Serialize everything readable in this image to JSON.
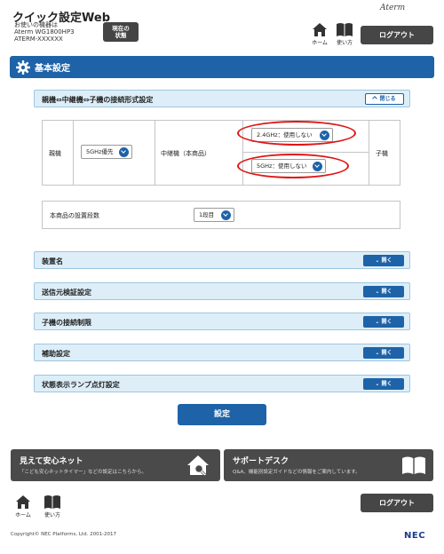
{
  "header": {
    "title": "クイック設定Web",
    "device_label": "お使いの機器は",
    "device_model": "Aterm WG1800HP3",
    "device_serial": "ATERM-XXXXXX",
    "status_button": "現在の\n状態",
    "brand": "Aterm",
    "home_label": "ホーム",
    "help_label": "使い方",
    "logout_label": "ログアウト"
  },
  "page_title": "基本設定",
  "connection_section": {
    "label": "親機⇔中継機⇔子機の接続形式設定",
    "close_button": "閉じる",
    "parent_label": "親機",
    "parent_select": "5GHz優先",
    "repeater_label": "中継機（本商品）",
    "repeater_24_select": "2.4GHz：使用しない",
    "repeater_5_select": "5GHz：使用しない",
    "child_label": "子機"
  },
  "install": {
    "label": "本商品の設置段数",
    "select": "1段目"
  },
  "sections": [
    {
      "label": "装置名",
      "button": "開く"
    },
    {
      "label": "送信元検証設定",
      "button": "開く"
    },
    {
      "label": "子機の接続制限",
      "button": "開く"
    },
    {
      "label": "補助設定",
      "button": "開く"
    },
    {
      "label": "状態表示ランプ点灯設定",
      "button": "開く"
    }
  ],
  "settings_button": "設定",
  "banners": {
    "left_title": "見えて安心ネット",
    "left_desc": "「こども安心ネットタイマー」などの設定はこちらから。",
    "right_title": "サポートデスク",
    "right_desc": "Q&A、機能別設定ガイドなどの情報をご案内しています。"
  },
  "footer": {
    "home_label": "ホーム",
    "help_label": "使い方",
    "logout_label": "ログアウト",
    "copyright": "Copyright© NEC Platforms, Ltd. 2001-2017",
    "logo": "NEC"
  }
}
